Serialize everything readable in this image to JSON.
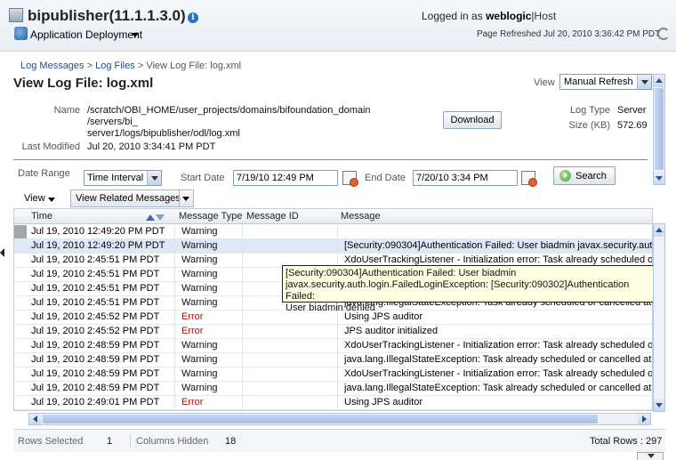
{
  "header": {
    "app_title": "bipublisher(11.1.1.3.0)",
    "app_menu": "Application Deployment",
    "logged_in_as": "Logged in as",
    "user": "weblogic",
    "host": "Host",
    "page_refreshed": "Page Refreshed Jul 20, 2010 3:36:42 PM PDT"
  },
  "breadcrumb": {
    "items": [
      "Log Messages",
      "Log Files"
    ],
    "sep": ">",
    "current": "View Log File: log.xml"
  },
  "page": {
    "title": "View Log File: log.xml",
    "view_label": "View",
    "view_selected": "Manual Refresh"
  },
  "details": {
    "name_label": "Name",
    "name_line1": "/scratch/OBI_HOME/user_projects/domains/bifoundation_domain",
    "name_line2": "/servers/bi_",
    "name_line3": "server1/logs/bipublisher/odl/log.xml",
    "last_modified_label": "Last Modified",
    "last_modified": "Jul 20, 2010 3:34:41 PM PDT",
    "download_label": "Download",
    "log_type_label": "Log Type",
    "log_type": "Server",
    "size_label": "Size (KB)",
    "size": "572.69"
  },
  "filter": {
    "date_range_label": "Date Range",
    "date_range_selected": "Time Interval",
    "start_date_label": "Start Date",
    "start_date": "7/19/10 12:49 PM",
    "end_date_label": "End Date",
    "end_date": "7/20/10 3:34 PM",
    "search_label": "Search"
  },
  "toolbar": {
    "view_menu": "View",
    "view_related": "View Related Messages"
  },
  "table": {
    "columns": [
      "Time",
      "Message Type",
      "Message ID",
      "Message"
    ],
    "rows": [
      {
        "time": "Jul 19, 2010 12:49:20 PM PDT",
        "type": "Warning",
        "id": "",
        "message": ""
      },
      {
        "time": "Jul 19, 2010 12:49:20 PM PDT",
        "type": "Warning",
        "id": "",
        "message": "[Security:090304]Authentication Failed: User biadmin javax.security.auth"
      },
      {
        "time": "Jul 19, 2010 2:45:51 PM PDT",
        "type": "Warning",
        "id": "",
        "message": "XdoUserTrackingListener - Initialization error: Task already scheduled or"
      },
      {
        "time": "Jul 19, 2010 2:45:51 PM PDT",
        "type": "Warning",
        "id": "",
        "message": ""
      },
      {
        "time": "Jul 19, 2010 2:45:51 PM PDT",
        "type": "Warning",
        "id": "",
        "message": ""
      },
      {
        "time": "Jul 19, 2010 2:45:51 PM PDT",
        "type": "Warning",
        "id": "",
        "message": "java.lang.IllegalStateException: Task already scheduled or cancelled at j"
      },
      {
        "time": "Jul 19, 2010 2:45:52 PM PDT",
        "type": "Error",
        "id": "",
        "message": "Using JPS auditor"
      },
      {
        "time": "Jul 19, 2010 2:45:52 PM PDT",
        "type": "Error",
        "id": "",
        "message": "JPS auditor initialized"
      },
      {
        "time": "Jul 19, 2010 2:48:59 PM PDT",
        "type": "Warning",
        "id": "",
        "message": "XdoUserTrackingListener - Initialization error: Task already scheduled or"
      },
      {
        "time": "Jul 19, 2010 2:48:59 PM PDT",
        "type": "Warning",
        "id": "",
        "message": "java.lang.IllegalStateException: Task already scheduled or cancelled at j"
      },
      {
        "time": "Jul 19, 2010 2:48:59 PM PDT",
        "type": "Warning",
        "id": "",
        "message": "XdoUserTrackingListener - Initialization error: Task already scheduled or"
      },
      {
        "time": "Jul 19, 2010 2:48:59 PM PDT",
        "type": "Warning",
        "id": "",
        "message": "java.lang.IllegalStateException: Task already scheduled or cancelled at j"
      },
      {
        "time": "Jul 19, 2010 2:49:01 PM PDT",
        "type": "Error",
        "id": "",
        "message": "Using JPS auditor"
      }
    ]
  },
  "tooltip": {
    "line1": "[Security:090304]Authentication Failed: User biadmin",
    "line2": "javax.security.auth.login.FailedLoginException: [Security:090302]Authentication Failed:",
    "line3": "User biadmin denied"
  },
  "footer": {
    "rows_selected_label": "Rows Selected",
    "rows_selected": "1",
    "columns_hidden_label": "Columns Hidden",
    "columns_hidden": "18",
    "total_rows": "Total Rows : 297"
  },
  "colors": {
    "accent": "#1f4e8c",
    "error": "#cc0000",
    "selected_row": "#dfe8f5",
    "tooltip_bg": "#ffffe1"
  },
  "icons": [
    "app-icon",
    "info-icon",
    "app-deployment-icon",
    "refresh-icon",
    "calendar-icon",
    "search-go-icon",
    "sort-asc-icon",
    "sort-desc-icon"
  ]
}
